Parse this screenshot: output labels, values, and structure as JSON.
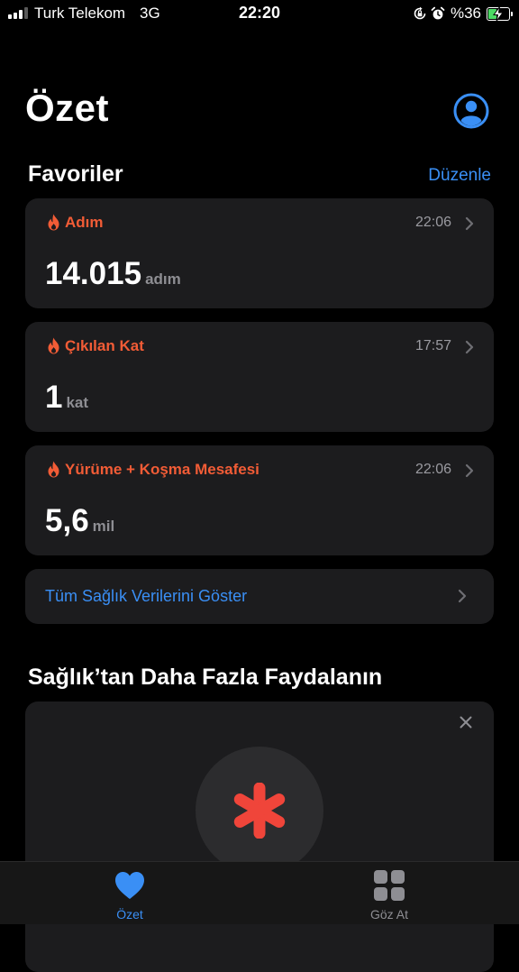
{
  "status_bar": {
    "carrier": "Turk Telekom",
    "network": "3G",
    "time": "22:20",
    "battery_percent": "%36",
    "battery_level": 0.36
  },
  "header": {
    "title": "Özet"
  },
  "favorites": {
    "title": "Favoriler",
    "edit_label": "Düzenle",
    "items": [
      {
        "label": "Adım",
        "time": "22:06",
        "value": "14.015",
        "unit": "adım"
      },
      {
        "label": "Çıkılan Kat",
        "time": "17:57",
        "value": "1",
        "unit": "kat"
      },
      {
        "label": "Yürüme + Koşma Mesafesi",
        "time": "22:06",
        "value": "5,6",
        "unit": "mil"
      }
    ],
    "show_all_label": "Tüm Sağlık Verilerini Göster"
  },
  "promo": {
    "title": "Sağlık’tan Daha Fazla Faydalanın"
  },
  "tab_bar": {
    "tabs": [
      {
        "label": "Özet",
        "icon": "heart-icon",
        "active": true
      },
      {
        "label": "Göz At",
        "icon": "grid-icon",
        "active": false
      }
    ]
  },
  "colors": {
    "accent_blue": "#3a8ff5",
    "activity_orange": "#f25c36",
    "health_red": "#f0453a",
    "card_background": "#1c1c1e"
  }
}
